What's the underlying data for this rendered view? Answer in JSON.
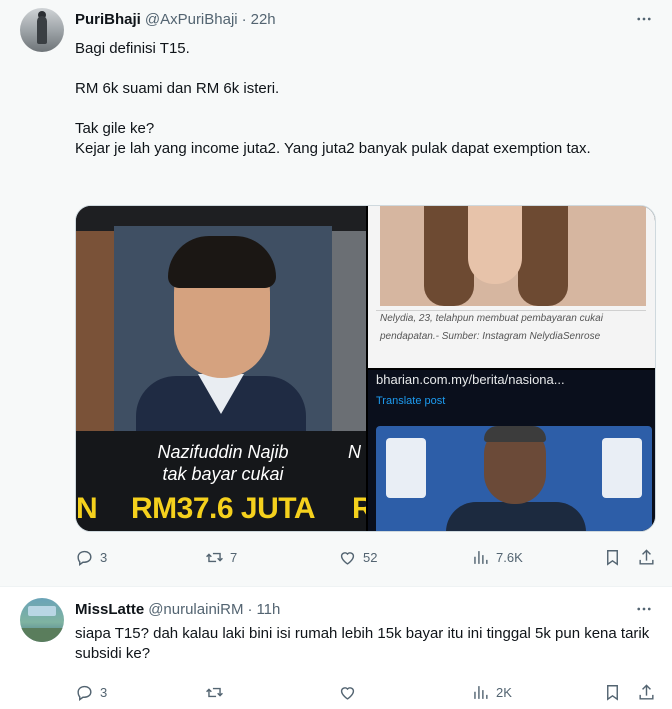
{
  "tweets": [
    {
      "display_name": "PuriBhaji",
      "handle": "@AxPuriBhaji",
      "separator": "·",
      "time": "22h",
      "paragraphs": [
        "Bagi definisi T15.",
        "RM 6k suami dan RM 6k isteri.",
        "Tak gile ke?\nKejar je lah yang income juta2. Yang juta2 banyak pulak dapat exemption tax."
      ],
      "media": {
        "left_caption_line1": "Nazifuddin Najib",
        "left_caption_line2": "tak bayar cukai",
        "left_caption_amount": "RM37.6 JUTA",
        "left_cut_text": "N",
        "right_cut_text_top": "N",
        "right_cut_text_bottom": "R",
        "top_right_caption": "Nelydia, 23, telahpun membuat pembayaran cukai pendapatan.- Sumber: Instagram NelydiaSenrose",
        "bottom_right_url": "bharian.com.my/berita/nasiona...",
        "bottom_right_translate": "Translate post"
      },
      "stats": {
        "replies": "3",
        "retweets": "7",
        "likes": "52",
        "views": "7.6K"
      }
    },
    {
      "display_name": "MissLatte",
      "handle": "@nurulainiRM",
      "separator": "·",
      "time": "11h",
      "paragraphs": [
        "siapa T15? dah kalau laki bini isi rumah lebih 15k bayar itu ini tinggal 5k pun kena tarik subsidi ke?"
      ],
      "stats": {
        "replies": "3",
        "retweets": "",
        "likes": "",
        "views": "2K"
      }
    }
  ],
  "icons": [
    "more-icon",
    "reply-icon",
    "retweet-icon",
    "like-icon",
    "views-icon",
    "bookmark-icon",
    "share-icon"
  ],
  "colors": {
    "text": "#0f1419",
    "muted": "#536471",
    "link": "#1d9bf0",
    "highlight_bg": "#f7f9f9",
    "accent_yellow": "#f5d11d"
  }
}
